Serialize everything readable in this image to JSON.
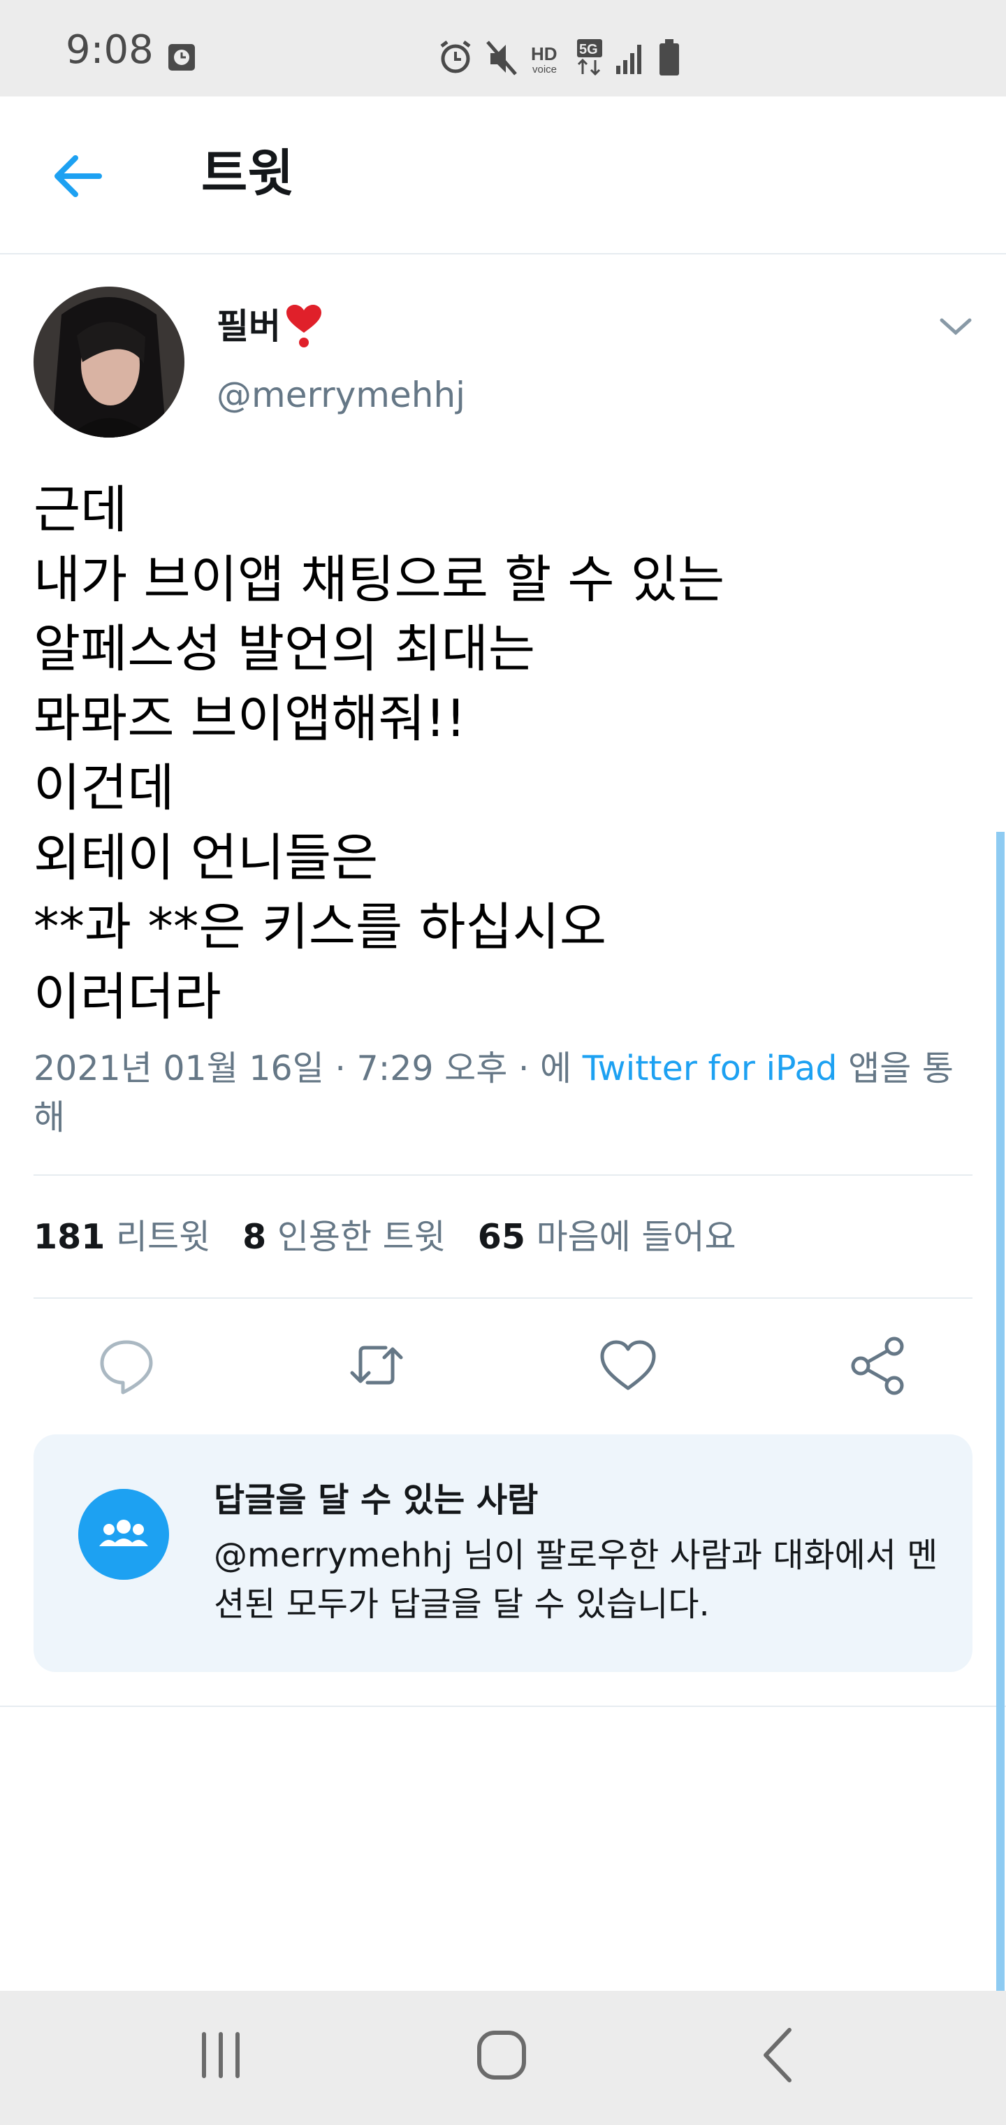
{
  "status_bar": {
    "time": "9:08",
    "icons": [
      "clock-icon",
      "alarm-icon",
      "mute-icon",
      "hd-voice-icon",
      "5g-icon",
      "signal-icon",
      "battery-icon"
    ],
    "hd_label": "HD",
    "voice_label": "voice",
    "net_label": "5G"
  },
  "header": {
    "title": "트윗",
    "back_icon": "arrow-left-icon"
  },
  "tweet": {
    "author_name": "필버",
    "author_emoji": "heavy-heart-exclamation",
    "handle": "@merrymehhj",
    "lines": [
      "근데",
      "내가 브이앱 채팅으로 할 수 있는",
      "알페스성 발언의 최대는",
      "뫄뫄즈 브이앱해줘!!",
      "이건데",
      "외테이 언니들은",
      "**과 **은 키스를 하십시오",
      "이러더라"
    ],
    "meta_prefix": "2021년 01월 16일 · 7:29 오후 · 에 ",
    "meta_link": "Twitter for iPad",
    "meta_suffix": " 앱을 통해",
    "stats": {
      "retweets_count": "181",
      "retweets_label": "리트윗",
      "quotes_count": "8",
      "quotes_label": "인용한 트윗",
      "likes_count": "65",
      "likes_label": "마음에 들어요"
    }
  },
  "actions": [
    "reply-icon",
    "retweet-icon",
    "like-icon",
    "share-icon"
  ],
  "reply_card": {
    "title": "답글을 달 수 있는 사람",
    "body": "@merrymehhj 님이 팔로우한 사람과 대화에서 멘션된 모두가 답글을 달 수 있습니다."
  },
  "colors": {
    "accent": "#1da1f2",
    "secondary_text": "#657786",
    "divider": "#e6ecf0",
    "card_bg": "#eef5fb"
  },
  "nav_bar": [
    "recent-apps-icon",
    "home-icon",
    "back-icon"
  ]
}
